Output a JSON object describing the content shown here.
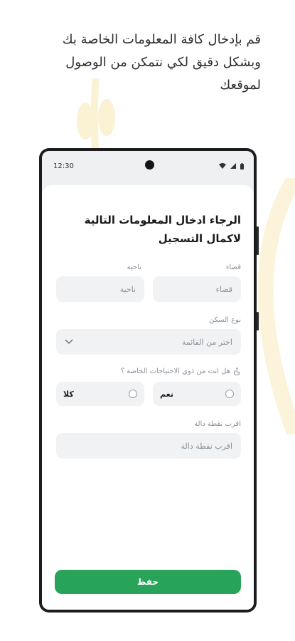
{
  "promo": {
    "lines": [
      "قم بإدخال كافة المعلومات الخاصة بك",
      "وبشكل دقيق لكي نتمكن من الوصول",
      "لموقعك"
    ]
  },
  "status_bar": {
    "time": "12:30"
  },
  "form": {
    "title_lines": [
      "الرجاء ادخال المعلومات التالية",
      "لاكمال التسجيل"
    ],
    "district": {
      "label": "قضاء",
      "placeholder": "قضاء"
    },
    "subdistrict": {
      "label": "ناحية",
      "placeholder": "ناحية"
    },
    "housing_type": {
      "label": "نوع السكن",
      "placeholder": "اختر من القائمة"
    },
    "special_needs": {
      "label": "هل انت من ذوي الاحتياجات الخاصة ؟",
      "yes": "نعم",
      "no": "كلا"
    },
    "landmark": {
      "label": "اقرب نقطة دالة",
      "placeholder": "اقرب نقطة دالة"
    },
    "save_label": "حفظ"
  },
  "colors": {
    "accent": "#27a35a",
    "field_bg": "#f1f2f4",
    "deco": "#fbf3da"
  },
  "icons": [
    "wifi-icon",
    "signal-icon",
    "battery-icon",
    "chevron-down-icon",
    "accessibility-icon",
    "radio-empty-icon"
  ]
}
